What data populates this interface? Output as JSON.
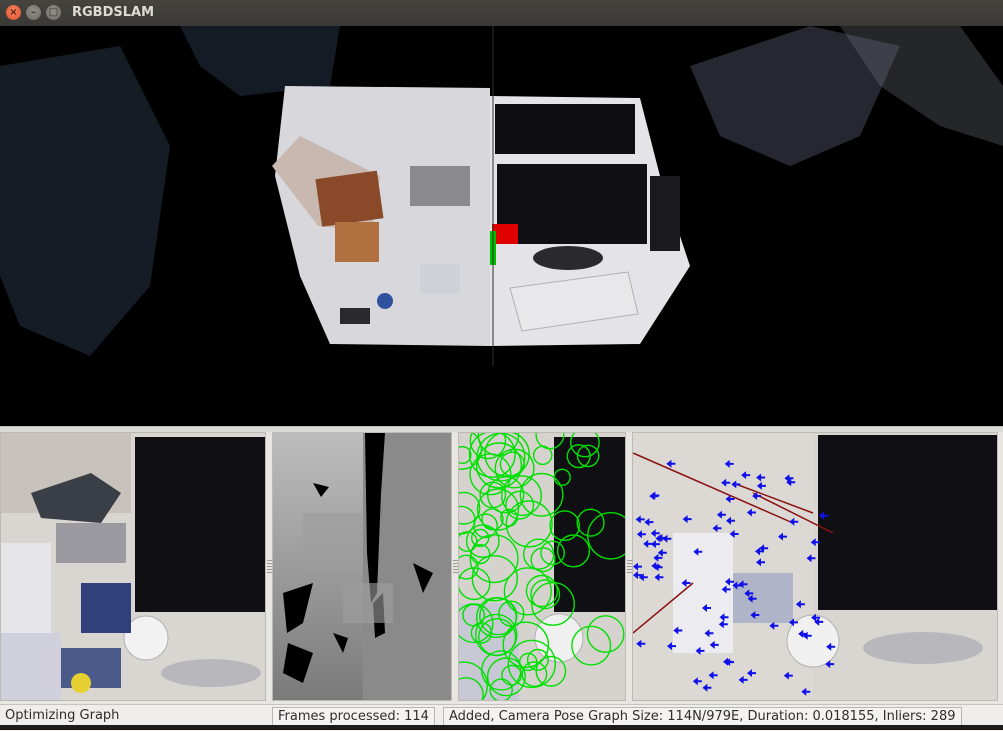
{
  "window": {
    "title": "RGBDSLAM",
    "close_glyph": "×",
    "minimize_glyph": "–",
    "maximize_glyph": "□"
  },
  "viewer": {
    "name": "3d-point-cloud-view"
  },
  "panes": [
    {
      "name": "rgb-image-pane"
    },
    {
      "name": "depth-image-pane"
    },
    {
      "name": "feature-keypoints-pane"
    },
    {
      "name": "feature-matches-pane"
    }
  ],
  "status": {
    "message": "Optimizing Graph",
    "frames": "Frames processed: 114",
    "graph": "Added, Camera Pose Graph Size: 114N/979E, Duration: 0.018155, Inliers:  289"
  },
  "colors": {
    "keypoint": "#00e000",
    "match_arrow": "#1010e8",
    "match_line": "#8a1010"
  }
}
